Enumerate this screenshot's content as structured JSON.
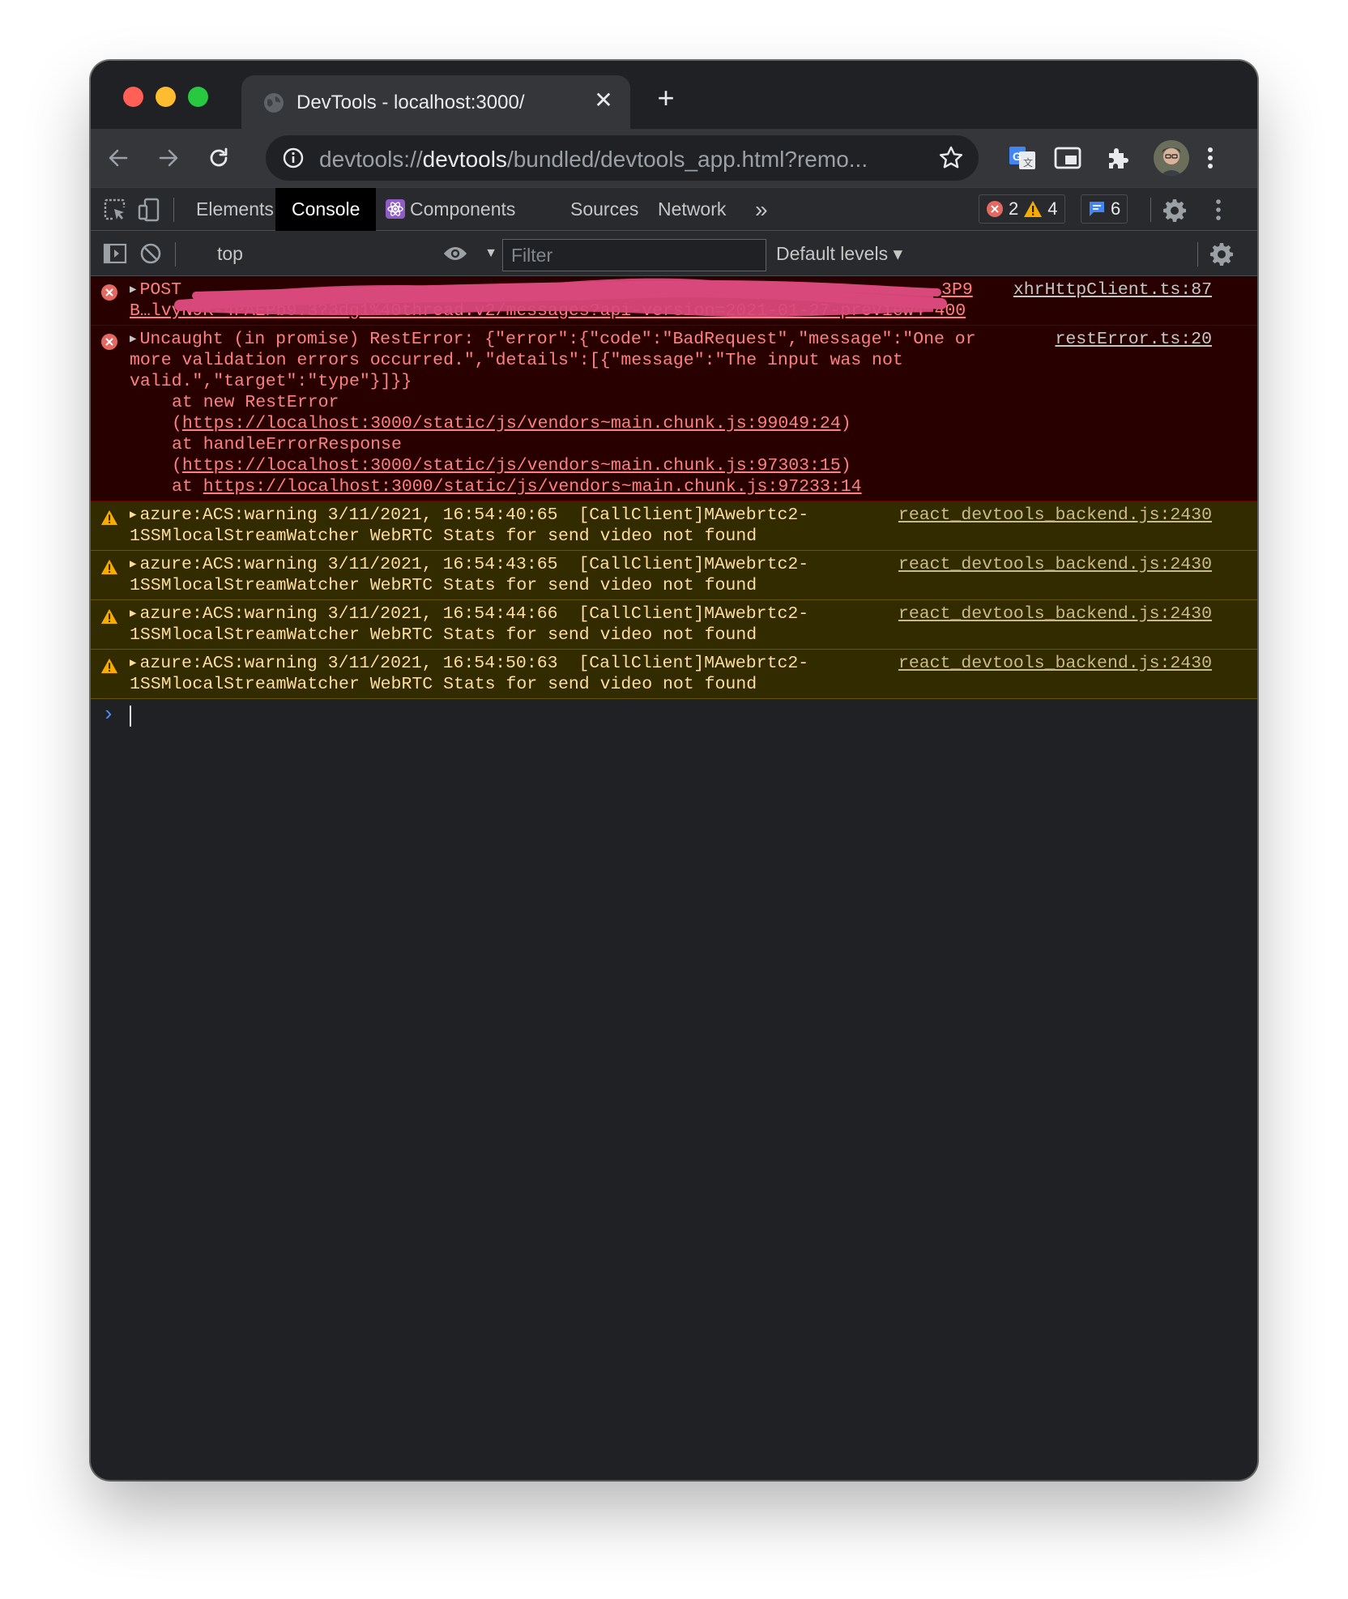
{
  "colors": {
    "window_bg": "#202124",
    "error_bg": "#290000",
    "error_text": "#ff8080",
    "warning_bg": "#332b00",
    "warning_text": "#ffdd9e",
    "redaction": "#d9487a",
    "prompt": "#4c8bf5"
  },
  "browser": {
    "tab_title": "DevTools - localhost:3000/",
    "tab_close": "✕",
    "new_tab": "+",
    "url_prefix": "devtools://",
    "url_host": "devtools",
    "url_rest": "/bundled/devtools_app.html?remo..."
  },
  "devtools": {
    "tabs": [
      "Elements",
      "Console",
      "Components",
      "Sources",
      "Network"
    ],
    "active_tab": "Console",
    "more_tabs": "»",
    "error_count": "2",
    "warning_count": "4",
    "info_count": "6"
  },
  "console_toolbar": {
    "context": "top",
    "context_caret": "▼",
    "filter_placeholder": "Filter",
    "filter_value": "",
    "levels": "Default levels ▾"
  },
  "messages": {
    "post": {
      "prefix": "POST",
      "line1_tail": "3P9",
      "line2": "B…lvyN9K-4PAEPb9.3?3dg1%40thread.v2/messages?api-version=2021-01-27-preview4 400",
      "source": "xhrHttpClient.ts:87"
    },
    "rest_error": {
      "text": "Uncaught (in promise) RestError: {\"error\":{\"code\":\"BadRequest\",\"message\":\"One or more validation errors occurred.\",\"details\":[{\"message\":\"The input was not valid.\",\"target\":\"type\"}]}}",
      "stack1_prefix": "at new RestError (",
      "stack1_link": "https://localhost:3000/static/js/vendors~main.chunk.js:99049:24",
      "stack1_suffix": ")",
      "stack2_prefix": "at handleErrorResponse (",
      "stack2_link": "https://localhost:3000/static/js/vendors~main.chunk.js:97303:15",
      "stack2_suffix": ")",
      "stack3_prefix": "at ",
      "stack3_link": "https://localhost:3000/static/js/vendors~main.chunk.js:97233:14",
      "source": "restError.ts:20"
    },
    "warnings": [
      {
        "text": "azure:ACS:warning 3/11/2021, 16:54:40:65  [CallClient]MAwebrtc2-1SSMlocalStreamWatcher WebRTC Stats for send video not found",
        "source": "react_devtools_backend.js:2430"
      },
      {
        "text": "azure:ACS:warning 3/11/2021, 16:54:43:65  [CallClient]MAwebrtc2-1SSMlocalStreamWatcher WebRTC Stats for send video not found",
        "source": "react_devtools_backend.js:2430"
      },
      {
        "text": "azure:ACS:warning 3/11/2021, 16:54:44:66  [CallClient]MAwebrtc2-1SSMlocalStreamWatcher WebRTC Stats for send video not found",
        "source": "react_devtools_backend.js:2430"
      },
      {
        "text": "azure:ACS:warning 3/11/2021, 16:54:50:63  [CallClient]MAwebrtc2-1SSMlocalStreamWatcher WebRTC Stats for send video not found",
        "source": "react_devtools_backend.js:2430"
      }
    ]
  },
  "prompt": {
    "symbol": "›"
  }
}
